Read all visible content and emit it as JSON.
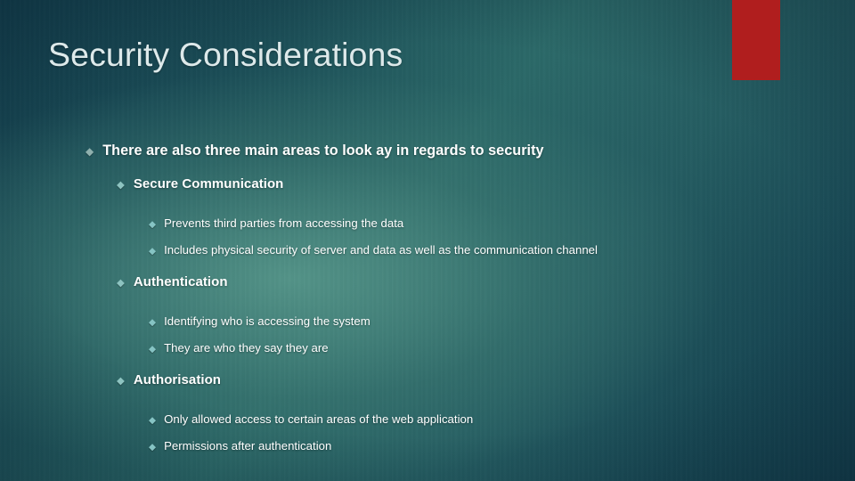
{
  "slide": {
    "title": "Security Considerations",
    "accent_color": "#b01e1e",
    "background_colors": {
      "edge_dark": "#123d4c",
      "center_light": "#3d7a72"
    },
    "bullet_glyph": "◆",
    "bullet_colors": {
      "level1": "#8fb0ae",
      "level2": "#8dc3c0",
      "level3": "#86c4c4"
    },
    "text_color": "#ffffff",
    "title_color": "#dde9ea"
  },
  "content": {
    "intro": "There are also three main areas to look ay in regards to security",
    "areas": [
      {
        "heading": "Secure Communication",
        "points": [
          "Prevents third parties from accessing the data",
          "Includes physical security of server and data as well as the communication channel"
        ]
      },
      {
        "heading": "Authentication",
        "points": [
          "Identifying who is accessing the system",
          "They are who they say they are"
        ]
      },
      {
        "heading": "Authorisation",
        "points": [
          "Only allowed access to certain areas of the web application",
          "Permissions after authentication"
        ]
      }
    ]
  }
}
